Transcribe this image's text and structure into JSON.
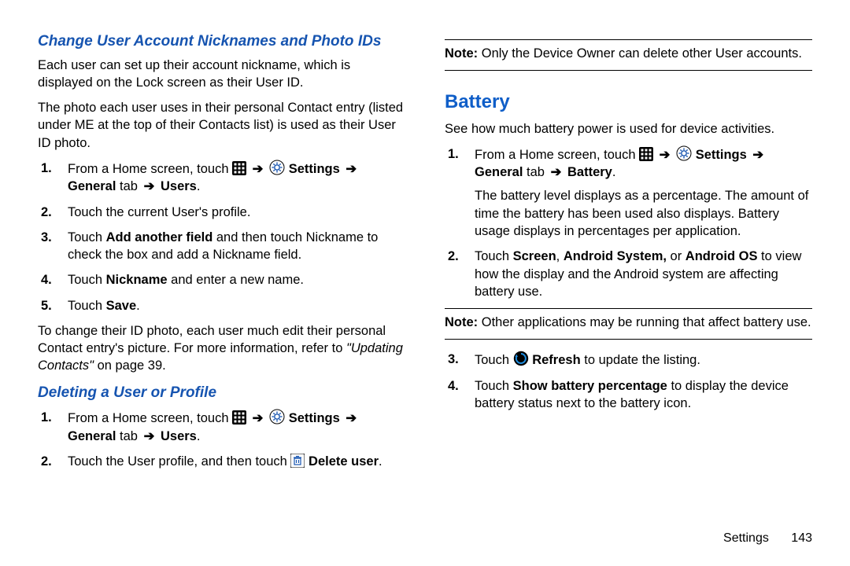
{
  "left": {
    "h_nick": "Change User Account Nicknames and Photo IDs",
    "p_nick1": "Each user can set up their account nickname, which is displayed on the Lock screen as their User ID.",
    "p_nick2": "The photo each user uses in their personal Contact entry (listed under ME at the top of their Contacts list) is used as their User ID photo.",
    "nick_steps": {
      "s1a": "From a Home screen, touch ",
      "s1_settings": "Settings",
      "s1_general": "General",
      "s1_tab": " tab ",
      "s1_users": "Users",
      "s1_end": ".",
      "s2": "Touch the current User's profile.",
      "s3a": "Touch ",
      "s3b": "Add another field",
      "s3c": " and then touch Nickname to check the box and add a Nickname field.",
      "s4a": "Touch ",
      "s4b": "Nickname",
      "s4c": " and enter a new name.",
      "s5a": "Touch ",
      "s5b": "Save",
      "s5c": "."
    },
    "p_nick3a": "To change their ID photo, each user much edit their personal Contact entry's picture. For more information, refer to ",
    "p_nick3b": "\"Updating Contacts\"",
    "p_nick3c": " on page 39.",
    "h_del": "Deleting a User or Profile",
    "del_steps": {
      "s1a": "From a Home screen, touch ",
      "s1_settings": "Settings",
      "s1_general": "General",
      "s1_tab": " tab ",
      "s1_users": "Users",
      "s1_end": ".",
      "s2a": "Touch the User profile, and then touch ",
      "s2b": "Delete user",
      "s2c": "."
    }
  },
  "right": {
    "note1a": "Note:",
    "note1b": " Only the Device Owner can delete other User accounts.",
    "h_bat": "Battery",
    "p_bat1": "See how much battery power is used for device activities.",
    "bat_steps": {
      "s1a": "From a Home screen, touch ",
      "s1_settings": "Settings",
      "s1_general": "General",
      "s1_tab": " tab ",
      "s1_battery": "Battery",
      "s1_end": ".",
      "s1_p": "The battery level displays as a percentage. The amount of time the battery has been used also displays. Battery usage displays in percentages per application.",
      "s2a": "Touch ",
      "s2b": "Screen",
      "s2c": ", ",
      "s2d": "Android System,",
      "s2e": " or ",
      "s2f": "Android OS",
      "s2g": " to view how the display and the Android system are affecting battery use.",
      "s3a": "Touch ",
      "s3b": "Refresh",
      "s3c": " to update the listing.",
      "s4a": "Touch ",
      "s4b": "Show battery percentage",
      "s4c": " to display the device battery status next to the battery icon."
    },
    "note2a": "Note:",
    "note2b": " Other applications may be running that affect battery use."
  },
  "footer": {
    "section": "Settings",
    "page": "143"
  }
}
